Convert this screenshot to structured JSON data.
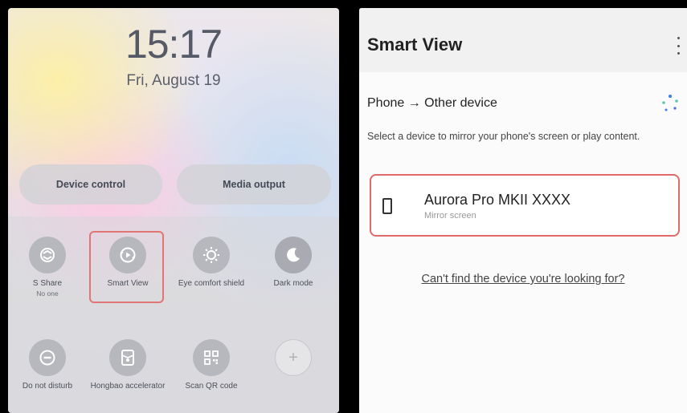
{
  "quick_panel": {
    "time": "15:17",
    "date": "Fri, August 19",
    "device_control_label": "Device control",
    "media_output_label": "Media output",
    "tiles": [
      {
        "label": "S Share",
        "sub": "No one",
        "icon": "s-share-icon"
      },
      {
        "label": "Smart View",
        "sub": "",
        "icon": "smart-view-icon"
      },
      {
        "label": "Eye comfort shield",
        "sub": "",
        "icon": "eye-comfort-icon"
      },
      {
        "label": "Dark mode",
        "sub": "",
        "icon": "moon-icon"
      },
      {
        "label": "Do not disturb",
        "sub": "",
        "icon": "do-not-disturb-icon"
      },
      {
        "label": "Hongbao accelerator",
        "sub": "",
        "icon": "hongbao-icon"
      },
      {
        "label": "Scan QR code",
        "sub": "",
        "icon": "qr-code-icon"
      },
      {
        "label": "+",
        "sub": "",
        "icon": "add-icon"
      }
    ]
  },
  "smart_view": {
    "title": "Smart View",
    "section_title": "Phone → Other device",
    "description": "Select a device to mirror your phone's screen or play content.",
    "device_name": "Aurora Pro MKII XXXX",
    "device_subtitle": "Mirror screen",
    "help_link": "Can't find the device you're looking for?"
  },
  "colors": {
    "highlight": "#e06a6a",
    "tile_circle": "#b7b8be",
    "spinner_dots": [
      "#3b7de0",
      "#5cc8b0",
      "#4a6fd6"
    ]
  }
}
